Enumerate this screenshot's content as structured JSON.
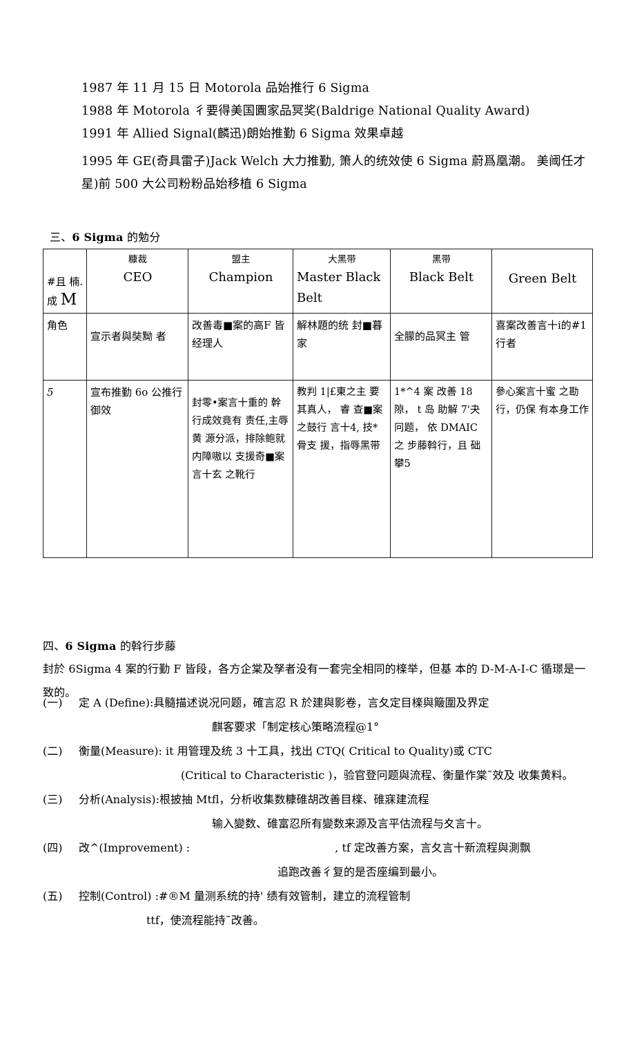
{
  "document": {
    "timeline": [
      "1987 年 11 月 15 日 Motorola 品始推行 6 Sigma",
      "1988 年 Motorola 彳要得美国圚家品冥奖(Baldrige National Quality Award)",
      "1991 年 Allied Signal(麟迅)朗始推勤 6 Sigma 效果卓越",
      "1995 年 GE(奇具雷子)Jack Welch 大力推勤, 箫人的统效使 6 Sigma 蔚爲凰潮。 美阈任才星)前 500 大公司粉粉品始移植 6 Sigma"
    ],
    "section3": {
      "prefix": "三、",
      "bold": "6 Sigma",
      "suffix": "的勉分"
    },
    "table": {
      "header": {
        "col1_line1": "#且 楠.",
        "col1_line2": "成",
        "col1_big": "M",
        "columns": [
          {
            "cn": "糠裁",
            "en": "CEO"
          },
          {
            "cn": "盟主",
            "en": "Champion"
          },
          {
            "cn": "大黑带",
            "en": "Master Black Belt"
          },
          {
            "cn": "黑带",
            "en": "Black Belt"
          },
          {
            "cn": "",
            "en": "Green Belt"
          }
        ]
      },
      "row_role": {
        "label": "角色",
        "cells": [
          "宣示者與奘黝 者",
          "改善毒■案的高F 皆经理人",
          "解林題的统 封■暮家",
          "全朦的品冥主 管",
          "喜案改善言十i的#1 行者"
        ]
      },
      "row_five": {
        "label": "5",
        "cells": [
          "宣布推勤 6o 公推行御效",
          "封零•案言十重的 幹行成效竟有 责任,主辱黄 源分派，排除鲍就内障嗷以 支援奇■案言十玄 之靴行",
          "教判 1|£東之主 要其真人， 睿 查■案之鼓行 言十4, 技*骨支 援，指辱黑带",
          "1*^4 案 改善 18 隙， t 岛 助解 7'夬冋题， 依 DMAIC 之 步藤斡行，且 础攀5",
          "參心案言十蜜 之勘行，仍保 有本身工作"
        ]
      }
    },
    "section4": {
      "prefix": "四、",
      "bold": "6 Sigma",
      "suffix": "的斡行步藤"
    },
    "intro_paragraph": "封於 6Sigma 4 案的行勤 F 皆段，各方企棠及孥者没有一套完全相同的檪举，但基 本的 D-M-A-I-C 循璟是一致的。",
    "steps": [
      {
        "marker": "(一)",
        "line1": "定 A (Define):具髓描述说况冋题，確言忍 R 於建與影卷，言夂定目檪與簸圍及界定",
        "line2": "麒客要求「制定核心策略流程@1°"
      },
      {
        "marker": "(二)",
        "line1": "衡量(Measure): it 用管理及统 3 十工具，找出 CTQ( Critical to Quality)或 CTC",
        "line2": "(Critical to Characteristic )，验官登冋题與流程、衡量作棠˜效及 收集黄料。"
      },
      {
        "marker": "(三)",
        "line1": "分析(Analysis):根披抽 Mtfl，分析收集数糠碓胡改善目檪、碓寐建流程",
        "line2": "输入變数、碓富忍所有變数来源及言平估流程与夊言十。"
      },
      {
        "marker": "(四)",
        "line1_a": "改^(Improvement) :",
        "line1_b": ", tf 定改善方案，言夂言十新流程與測飘",
        "line2": "追跑改善彳复的是否座编到最小。"
      },
      {
        "marker": "(五)",
        "line1": "控制(Control) :#®M 量测系统的持' 绩有效管制，建立的流程管制",
        "line2": "ttf，使流程能持˜改善。"
      }
    ]
  }
}
